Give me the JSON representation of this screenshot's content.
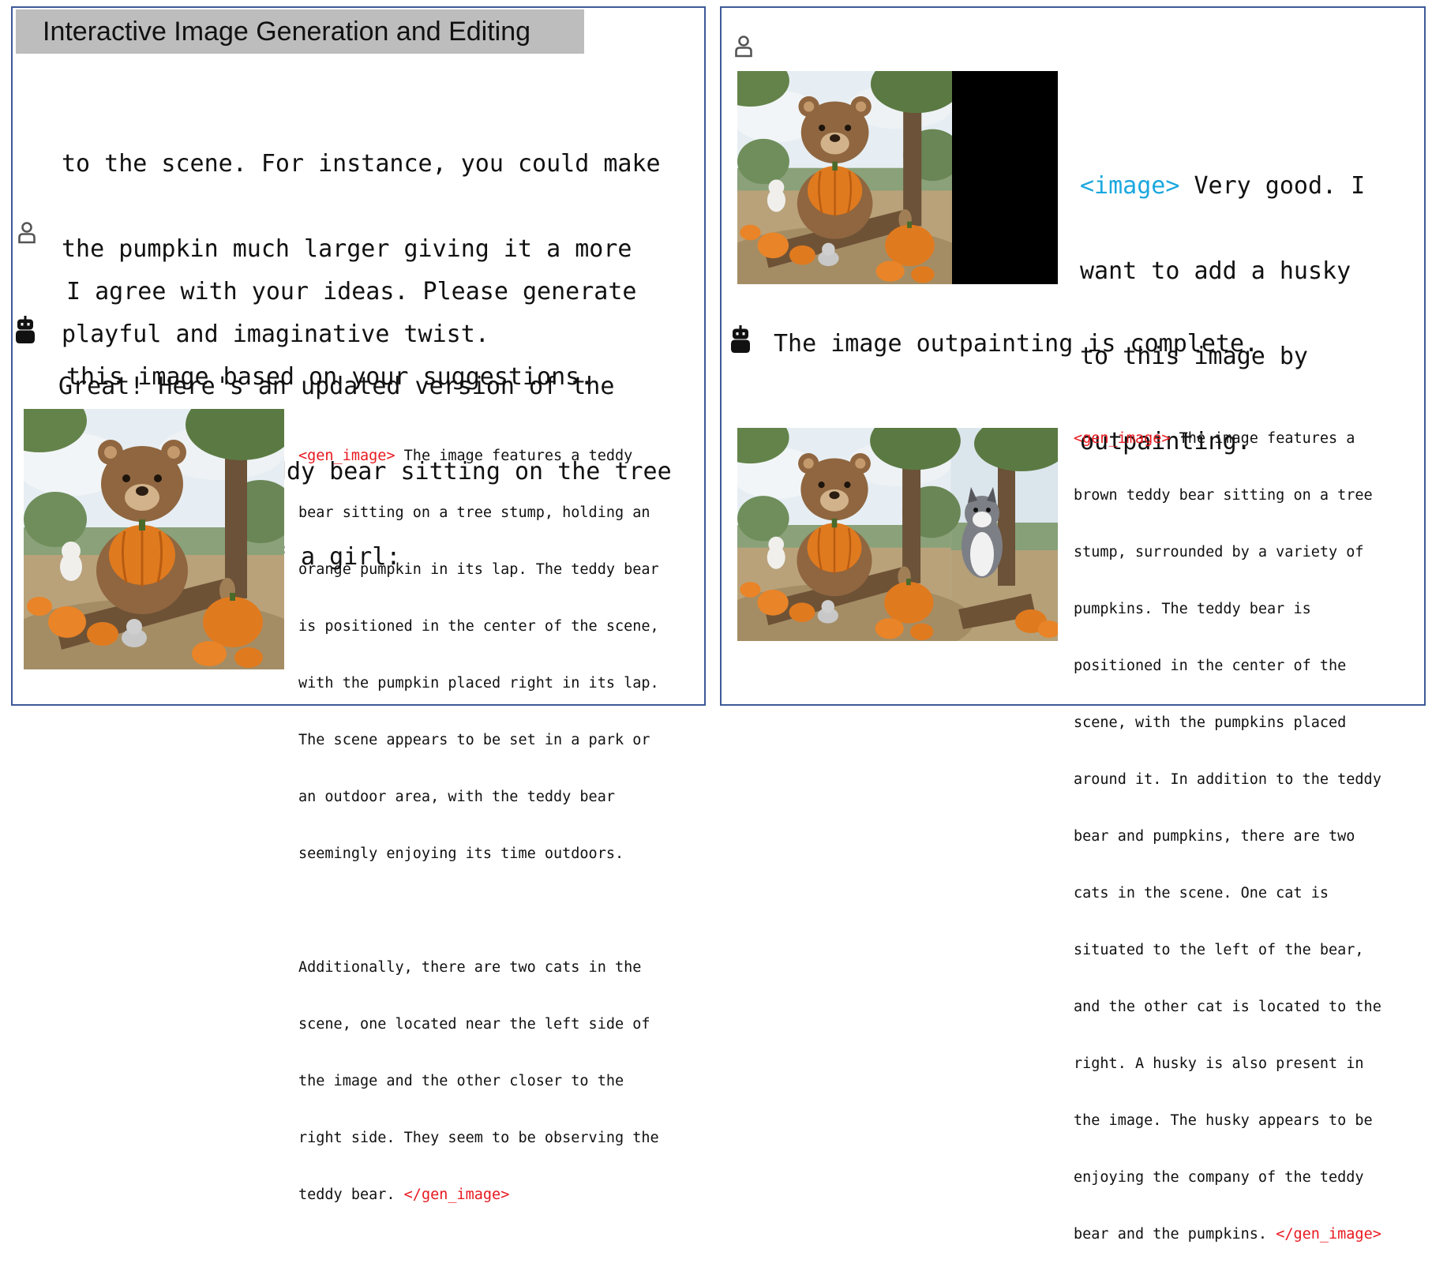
{
  "title": "Interactive Image Generation and Editing",
  "tags": {
    "gen_open": "<gen_image>",
    "gen_close": "</gen_image>",
    "image": "<image>"
  },
  "left": {
    "assistant_cont": [
      "to the scene. For instance, you could make",
      "the pumpkin much larger giving it a more",
      "playful and imaginative twist."
    ],
    "user_msg": [
      "I agree with your ideas. Please generate",
      "this image based on your suggestions."
    ],
    "assistant_msg": [
      "Great! Here's an updated version of the",
      "image with a teddy bear sitting on the tree",
      "stump instead of a girl:"
    ],
    "caption_lines": [
      "The image features a teddy",
      "bear sitting on a tree stump, holding an",
      "orange pumpkin in its lap. The teddy bear",
      "is positioned in the center of the scene,",
      "with the pumpkin placed right in its lap.",
      "The scene appears to be set in a park or",
      "an outdoor area, with the teddy bear",
      "seemingly enjoying its time outdoors.",
      "",
      "Additionally, there are two cats in the",
      "scene, one located near the left side of",
      "the image and the other closer to the",
      "right side. They seem to be observing the",
      "teddy bear."
    ]
  },
  "right": {
    "user_msg": [
      "Very good. I",
      "want to add a husky",
      "to this image by",
      "outpainting."
    ],
    "assistant_msg": "The image outpainting is complete.",
    "caption_lines": [
      "The image features a",
      "brown teddy bear sitting on a tree",
      "stump, surrounded by a variety of",
      "pumpkins. The teddy bear is",
      "positioned in the center of the",
      "scene, with the pumpkins placed",
      "around it. In addition to the teddy",
      "bear and pumpkins, there are two",
      "cats in the scene. One cat is",
      "situated to the left of the bear,",
      "and the other cat is located to the",
      "right. A husky is also present in",
      "the image. The husky appears to be",
      "enjoying the company of the teddy",
      "bear and the pumpkins."
    ]
  }
}
